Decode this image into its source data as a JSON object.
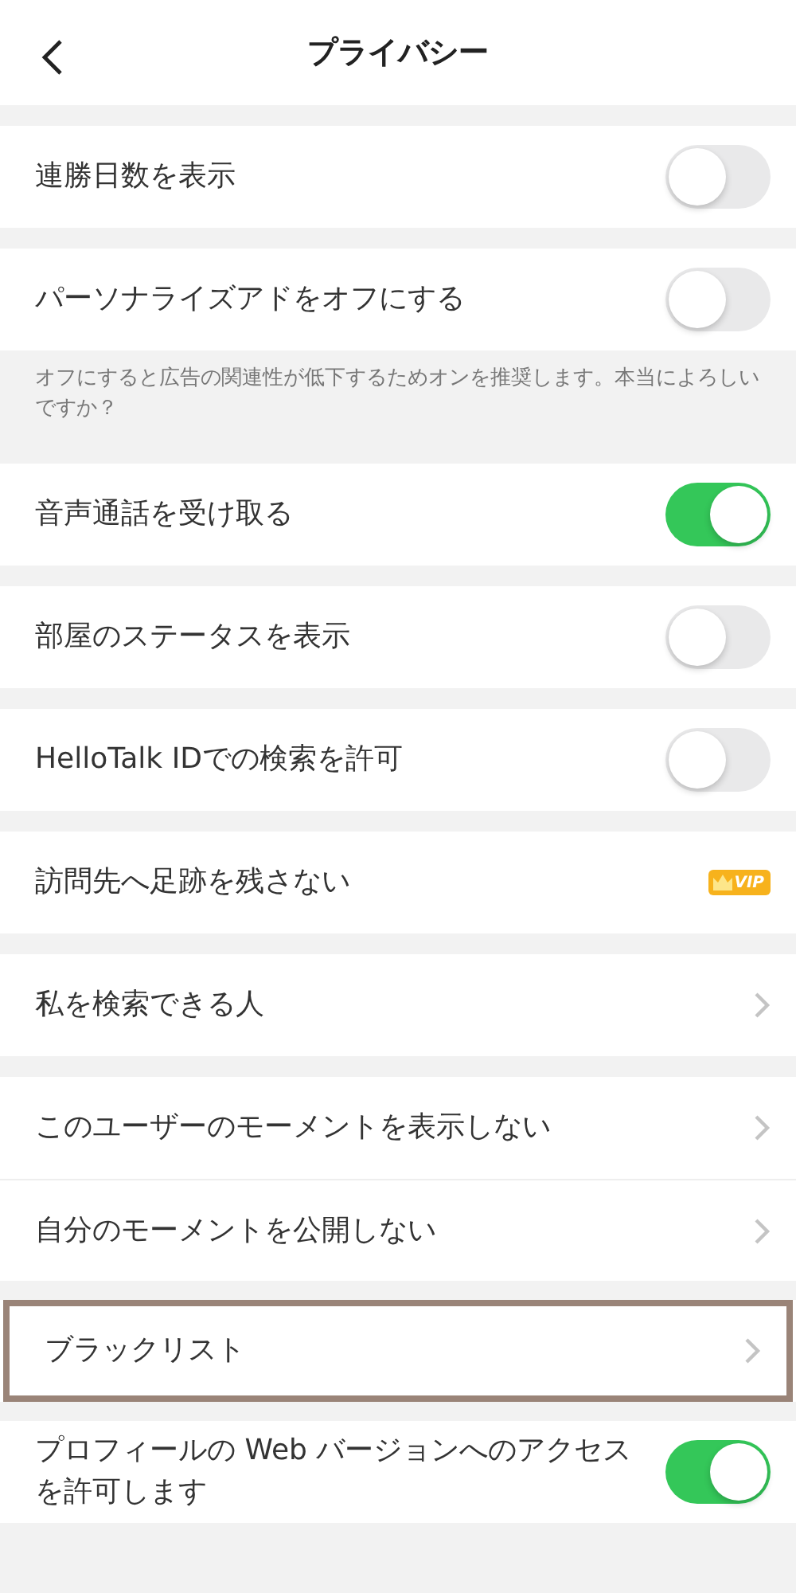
{
  "header": {
    "title": "プライバシー"
  },
  "sections": [
    {
      "rows": [
        {
          "kind": "toggle",
          "label": "連勝日数を表示",
          "on": false,
          "highlighted": false
        }
      ]
    },
    {
      "rows": [
        {
          "kind": "toggle",
          "label": "パーソナライズアドをオフにする",
          "on": false,
          "highlighted": false
        }
      ],
      "note": "オフにすると広告の関連性が低下するためオンを推奨します。本当によろしいですか？"
    },
    {
      "rows": [
        {
          "kind": "toggle",
          "label": "音声通話を受け取る",
          "on": true,
          "highlighted": false
        }
      ]
    },
    {
      "rows": [
        {
          "kind": "toggle",
          "label": "部屋のステータスを表示",
          "on": false,
          "highlighted": false
        }
      ]
    },
    {
      "rows": [
        {
          "kind": "toggle",
          "label": "HelloTalk IDでの検索を許可",
          "on": false,
          "highlighted": false
        }
      ]
    },
    {
      "rows": [
        {
          "kind": "vip",
          "label": "訪問先へ足跡を残さない",
          "badge": "VIP",
          "highlighted": false
        }
      ]
    },
    {
      "rows": [
        {
          "kind": "link",
          "label": "私を検索できる人",
          "highlighted": false
        }
      ]
    },
    {
      "rows": [
        {
          "kind": "link",
          "label": "このユーザーのモーメントを表示しない",
          "highlighted": false
        },
        {
          "kind": "link",
          "label": "自分のモーメントを公開しない",
          "highlighted": false
        }
      ]
    },
    {
      "rows": [
        {
          "kind": "link",
          "label": "ブラックリスト",
          "highlighted": true
        }
      ]
    },
    {
      "rows": [
        {
          "kind": "toggle",
          "label": "プロフィールの Web バージョンへのアクセスを許可します",
          "on": true,
          "highlighted": false
        }
      ]
    }
  ]
}
